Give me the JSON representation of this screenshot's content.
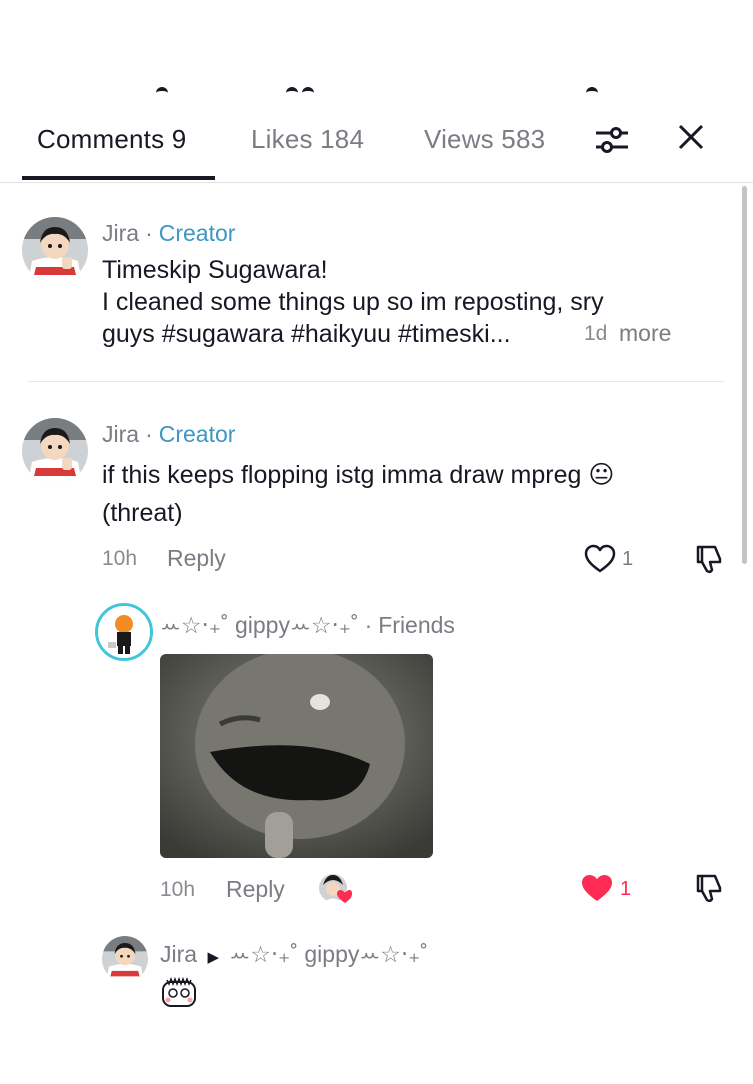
{
  "tabs": {
    "comments": "Comments 9",
    "likes": "Likes 184",
    "views": "Views 583"
  },
  "comment1": {
    "author": "Jira",
    "badge": "Creator",
    "line1": "Timeskip Sugawara!",
    "line2": "I cleaned some things up so im reposting, sry",
    "line3": "guys #sugawara #haikyuu #timeski...",
    "time": "1d",
    "more": "more"
  },
  "comment2": {
    "author": "Jira",
    "badge": "Creator",
    "line1": "if this keeps flopping istg imma draw mpreg 😐",
    "line2": "(threat)",
    "time": "10h",
    "reply": "Reply",
    "likes": "1"
  },
  "reply1": {
    "author": "ꕀ☆‧₊˚ gippyꕀ☆‧₊˚",
    "badge": "Friends",
    "time": "10h",
    "reply": "Reply",
    "likes": "1"
  },
  "reply2": {
    "author": "Jira",
    "target": "ꕀ☆‧₊˚ gippyꕀ☆‧₊˚"
  },
  "colors": {
    "accent": "#3f96c2",
    "like": "#fe2c55",
    "text": "#161823",
    "muted": "#7b7c84"
  }
}
